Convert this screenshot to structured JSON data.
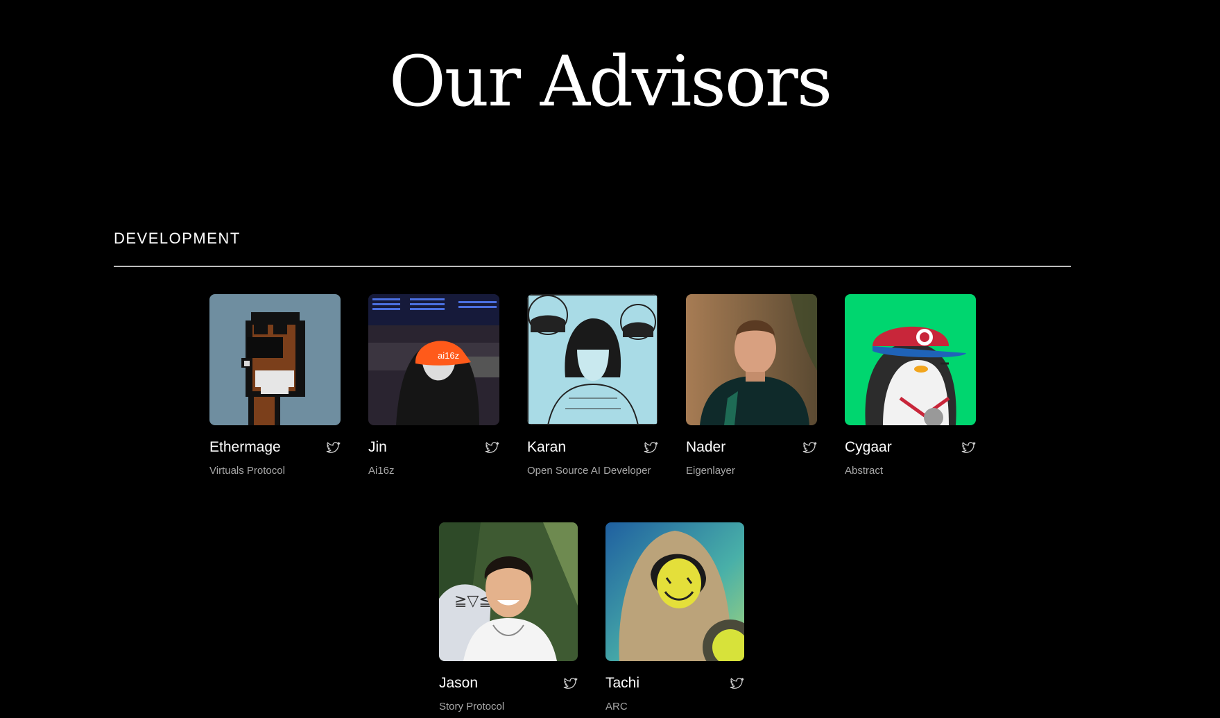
{
  "page": {
    "title": "Our Advisors"
  },
  "section": {
    "label": "DEVELOPMENT"
  },
  "advisors": [
    {
      "name": "Ethermage",
      "org": "Virtuals Protocol",
      "avatar": "pixel-punk-avatar",
      "bg": "#6f8ea0"
    },
    {
      "name": "Jin",
      "org": "Ai16z",
      "avatar": "hooded-figure-orange-cap-avatar",
      "bg": "#2a2430"
    },
    {
      "name": "Karan",
      "org": "Open Source AI Developer",
      "avatar": "manga-girl-sketch-avatar",
      "bg": "#a9dbe6"
    },
    {
      "name": "Nader",
      "org": "Eigenlayer",
      "avatar": "man-portrait-photo-avatar",
      "bg": "#8a6a48"
    },
    {
      "name": "Cygaar",
      "org": "Abstract",
      "avatar": "penguin-red-cap-avatar",
      "bg": "#00d66f"
    },
    {
      "name": "Jason",
      "org": "Story Protocol",
      "avatar": "smiling-man-photo-avatar",
      "bg": "#3e5a32"
    },
    {
      "name": "Tachi",
      "org": "ARC",
      "avatar": "hooded-smiley-avatar",
      "bg": "#2f8fb0"
    }
  ],
  "icons": {
    "social": "twitter-icon"
  }
}
